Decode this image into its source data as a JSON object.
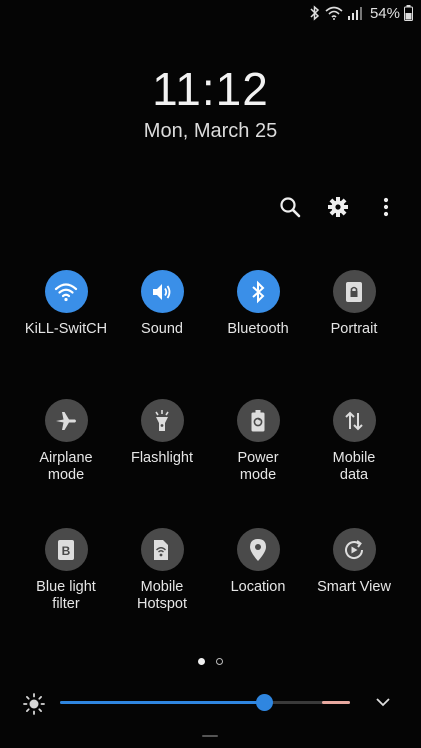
{
  "status_bar": {
    "battery_percent": "54%",
    "icons": [
      "bluetooth-icon",
      "wifi-icon",
      "cell-signal-icon",
      "battery-icon"
    ]
  },
  "clock": {
    "time": "11:12",
    "date": "Mon, March 25"
  },
  "actions": [
    "search-icon",
    "gear-icon",
    "more-vertical-icon"
  ],
  "tiles": [
    {
      "label": "KiLL-SwitCH",
      "icon": "wifi-icon",
      "on": true
    },
    {
      "label": "Sound",
      "icon": "speaker-icon",
      "on": true
    },
    {
      "label": "Bluetooth",
      "icon": "bluetooth-icon",
      "on": true
    },
    {
      "label": "Portrait",
      "icon": "portrait-lock-icon",
      "on": false
    },
    {
      "label": "Airplane\nmode",
      "icon": "airplane-icon",
      "on": false
    },
    {
      "label": "Flashlight",
      "icon": "flashlight-icon",
      "on": false
    },
    {
      "label": "Power\nmode",
      "icon": "power-mode-icon",
      "on": false
    },
    {
      "label": "Mobile\ndata",
      "icon": "mobile-data-icon",
      "on": false
    },
    {
      "label": "Blue light\nfilter",
      "icon": "blue-light-filter-icon",
      "on": false
    },
    {
      "label": "Mobile\nHotspot",
      "icon": "hotspot-icon",
      "on": false
    },
    {
      "label": "Location",
      "icon": "location-pin-icon",
      "on": false
    },
    {
      "label": "Smart View",
      "icon": "smart-view-icon",
      "on": false
    }
  ],
  "pager": {
    "count": 2,
    "active": 0
  },
  "brightness": {
    "level": 0.705
  },
  "colors": {
    "accent": "#3a8fe8",
    "tile_off": "#4a4a4a",
    "background": "#050505"
  }
}
